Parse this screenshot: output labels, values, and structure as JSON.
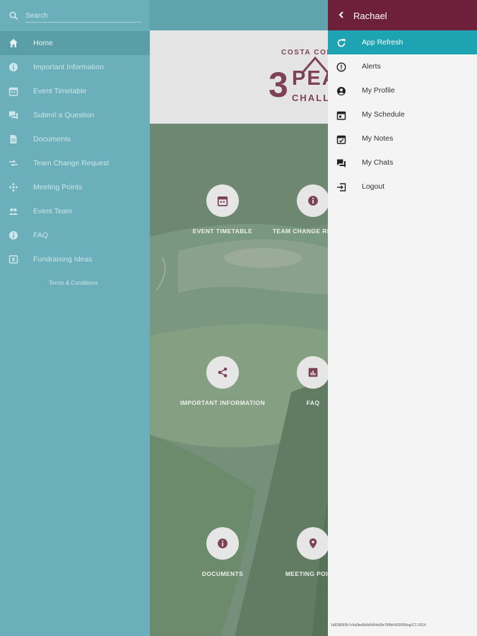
{
  "colors": {
    "left_drawer_bg": "#6aafba",
    "right_drawer_header": "#6e1f3a",
    "active_item": "#1ea3b2",
    "logo_color": "#7d4257"
  },
  "left_drawer": {
    "search": {
      "placeholder": "Search",
      "icon": "search-icon"
    },
    "items": [
      {
        "label": "Home",
        "icon": "home-icon",
        "active": true
      },
      {
        "label": "Important Information",
        "icon": "info-icon"
      },
      {
        "label": "Event Timetable",
        "icon": "calendar-icon"
      },
      {
        "label": "Submit a Question",
        "icon": "chat-icon"
      },
      {
        "label": "Documents",
        "icon": "document-icon"
      },
      {
        "label": "Team Change Request",
        "icon": "swap-icon"
      },
      {
        "label": "Meeting Points",
        "icon": "move-icon"
      },
      {
        "label": "Event Team",
        "icon": "people-icon"
      },
      {
        "label": "FAQ",
        "icon": "info-icon"
      },
      {
        "label": "Fundraising Ideas",
        "icon": "money-icon"
      }
    ],
    "terms_label": "Terms & Conditions"
  },
  "logo": {
    "top_text": "COSTA COFFEE",
    "number": "3",
    "peaks": "PEAKS",
    "challenge": "CHALLENGE"
  },
  "tiles": [
    {
      "label": "EVENT TIMETABLE",
      "icon": "calendar-icon"
    },
    {
      "label": "TEAM CHANGE REQUEST",
      "icon": "info-icon"
    },
    {
      "label": "IMPORTANT INFORMATION",
      "icon": "share-icon"
    },
    {
      "label": "FAQ",
      "icon": "chart-icon"
    },
    {
      "label": "DOCUMENTS",
      "icon": "info-icon"
    },
    {
      "label": "MEETING POINTS",
      "icon": "location-pin-icon"
    }
  ],
  "right_drawer": {
    "user_name": "Rachael",
    "items": [
      {
        "label": "App Refresh",
        "icon": "refresh-icon",
        "active": true
      },
      {
        "label": "Alerts",
        "icon": "alert-icon"
      },
      {
        "label": "My Profile",
        "icon": "profile-icon"
      },
      {
        "label": "My Schedule",
        "icon": "calendar-icon"
      },
      {
        "label": "My Notes",
        "icon": "notes-icon"
      },
      {
        "label": "My Chats",
        "icon": "chat-icon"
      },
      {
        "label": "Logout",
        "icon": "logout-icon"
      }
    ],
    "version": "1d928f3f3b7c4a0be8b6d9494d3fe7f0fb64926f9/log/CC-6314"
  }
}
